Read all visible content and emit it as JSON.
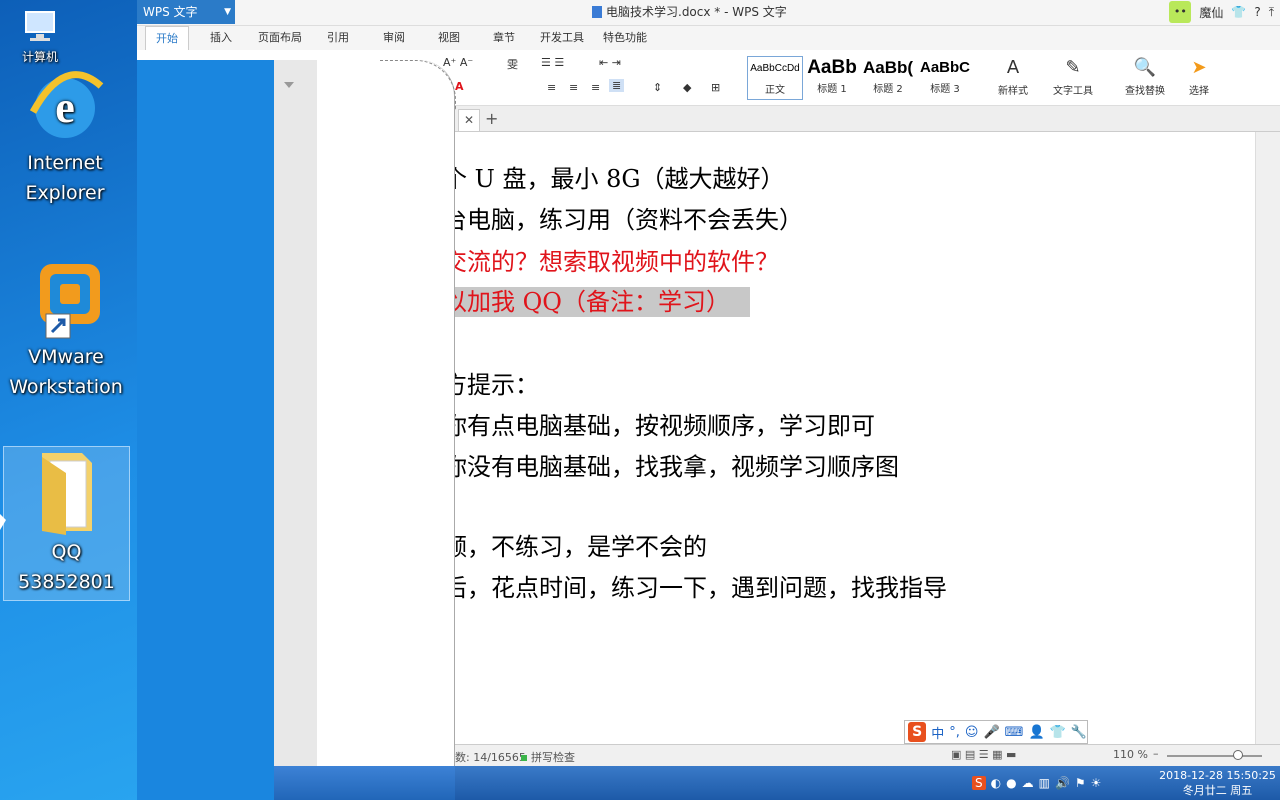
{
  "desktop": {
    "icons": [
      {
        "label": "计算机"
      },
      {
        "label_lines": [
          "Internet",
          "Explorer"
        ]
      },
      {
        "label_lines": [
          "VMware",
          "Workstation"
        ]
      },
      {
        "label_lines": [
          "QQ",
          "53852801"
        ]
      }
    ]
  },
  "wps": {
    "app_menu_label": "WPS 文字",
    "window_title": "电脑技术学习.docx * - WPS 文字",
    "user_name": "魔仙",
    "tabs": [
      "开始",
      "插入",
      "页面布局",
      "引用",
      "审阅",
      "视图",
      "章节",
      "开发工具",
      "特色功能"
    ],
    "styles": [
      {
        "sample": "AaBbCcDd",
        "label": "正文"
      },
      {
        "sample": "AaBb",
        "label": "标题 1"
      },
      {
        "sample": "AaBb(",
        "label": "标题 2"
      },
      {
        "sample": "AaBbC",
        "label": "标题 3"
      }
    ],
    "ribbon_buttons": {
      "new_style": "新样式",
      "text_tools": "文字工具",
      "find_replace": "查找替换",
      "select": "选择"
    }
  },
  "document": {
    "lines": [
      {
        "text": "个 U 盘，最小 8G（越大越好）",
        "style": "normal"
      },
      {
        "text": "台电脑，练习用（资料不会丢失）",
        "style": "normal"
      },
      {
        "text": "交流的？想索取视频中的软件？",
        "style": "red"
      },
      {
        "text": "以加我 QQ（备注：学习）",
        "style": "red-highlight"
      },
      {
        "text": "方提示：",
        "style": "normal"
      },
      {
        "text": "你有点电脑基础，按视频顺序，学习即可",
        "style": "normal"
      },
      {
        "text": "你没有电脑基础，找我拿，视频学习顺序图",
        "style": "normal"
      },
      {
        "text": "频，不练习，是学不会的",
        "style": "normal"
      },
      {
        "text": "后，花点时间，练习一下，遇到问题，找我指导",
        "style": "normal"
      }
    ]
  },
  "statusbar": {
    "word_count": "数: 14/16565",
    "spell_check": "拼写检查",
    "zoom": "110 %",
    "zoom_level_percent": 110
  },
  "ime": {
    "logo": "S",
    "mode": "中"
  },
  "taskbar": {
    "clock_datetime": "2018-12-28 15:50:25",
    "clock_lunar": "冬月廿二 周五"
  }
}
